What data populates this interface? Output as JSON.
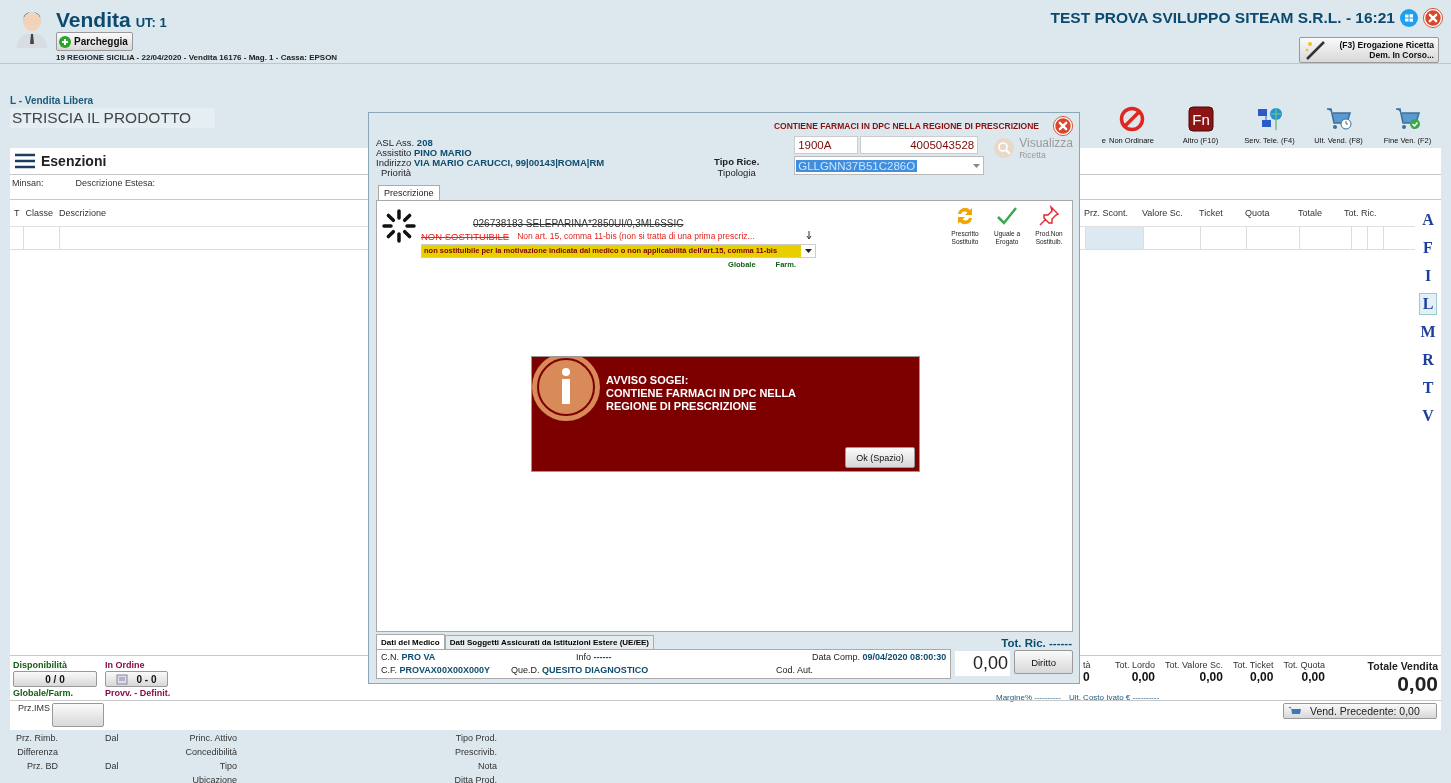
{
  "header": {
    "title": "Vendita",
    "user": "UT: 1",
    "park_button": "Parcheggia",
    "info": "19 REGIONE SICILIA - 22/04/2020 - Vendita 16176 - Mag. 1  - Cassa: EPSON",
    "company": "TEST PROVA SVILUPPO SITEAM S.R.L. - 16:21",
    "recipe_button": [
      "(F3) Erogazione Ricetta",
      "Dem. In Corso..."
    ]
  },
  "sale": {
    "mode": "L - Vendita Libera",
    "scan_prompt": "STRISCIA IL PRODOTTO"
  },
  "toolbar": [
    {
      "label": "e",
      "kind": "hidden"
    },
    {
      "label": "Non Ordinare",
      "kind": "no"
    },
    {
      "label": "Altro (F10)",
      "kind": "fn",
      "glyph": "Fn"
    },
    {
      "label": "Serv. Tele. (F4)",
      "kind": "network"
    },
    {
      "label": "Ult. Vend. (F8)",
      "kind": "recent"
    },
    {
      "label": "Fine Ven. (F2)",
      "kind": "finish"
    }
  ],
  "exemptions": {
    "title": "Esenzioni",
    "fields": [
      "Minsan:",
      "Descrizione Estesa:"
    ]
  },
  "table": {
    "columns_left": [
      "T",
      "Classe",
      "Descrizione"
    ],
    "columns_right": [
      "Prz. Scont.",
      "Valore Sc.",
      "Ticket",
      "Quota",
      "Totale",
      "Tot. Ric."
    ]
  },
  "index_letters": [
    {
      "label": "A",
      "selected": false
    },
    {
      "label": "F",
      "selected": false
    },
    {
      "label": "I",
      "selected": false
    },
    {
      "label": "L",
      "selected": true
    },
    {
      "label": "M",
      "selected": false
    },
    {
      "label": "R",
      "selected": false
    },
    {
      "label": "T",
      "selected": false
    },
    {
      "label": "V",
      "selected": false
    }
  ],
  "availability": {
    "label": "Disponibilità",
    "value": "0 / 0",
    "caption": "Globale/Farm."
  },
  "on_order": {
    "label": "In Ordine",
    "value": "0 - 0",
    "caption": "Provv. - Definit."
  },
  "totals": [
    {
      "label": "tà",
      "value": "0"
    },
    {
      "label": "Tot. Lordo",
      "value": "0,00"
    },
    {
      "label": "Tot. Valore Sc.",
      "value": "0,00"
    },
    {
      "label": "Tot. Ticket",
      "value": "0,00"
    },
    {
      "label": "Tot. Quota",
      "value": "0,00"
    }
  ],
  "grand_total": {
    "label": "Totale Vendita",
    "value": "0,00"
  },
  "margins": [
    "Margine% ----------",
    "Ult. Costo Ivato € ----------"
  ],
  "ims_label": "Prz.IMS",
  "previous_sale_button": "Vend. Precedente: 0,00",
  "details": [
    {
      "price": "Prz. Rimb.",
      "from": "Dal",
      "info": "Princ. Attivo",
      "product": "Tipo Prod."
    },
    {
      "price": "Differenza",
      "info": "Concedibilità",
      "product": "Prescrivib."
    },
    {
      "price": "Prz. BD",
      "from": "Dal",
      "info": "Tipo",
      "product": "Nota"
    },
    {
      "info": "Ubicazione",
      "product": "Ditta Prod."
    }
  ],
  "dialog": {
    "alert": "CONTIENE FARMACI IN DPC NELLA REGIONE DI PRESCRIZIONE",
    "asl": {
      "label": "ASL Ass.",
      "value": "208"
    },
    "patient": {
      "label": "Assistito",
      "value": "PINO MARIO"
    },
    "address": {
      "label": "Indirizzo",
      "value": "VIA MARIO CARUCCI, 99|00143|ROMA|RM"
    },
    "priority_label": "Priorità",
    "type_label": "Tipo Rice.",
    "typology_label": "Tipologia",
    "code": "1900A",
    "number": "4005043528",
    "tax_code": "GLLGNN37B51C286O",
    "view_button": {
      "lines": [
        "Visualizza",
        "Ricetta"
      ],
      "disabled": true
    },
    "tabs": [
      {
        "label": "Prescrizione",
        "selected": true
      }
    ],
    "product": {
      "name": "026738183  SELEPARINA*2850UI/0,3ML6SSIC",
      "status": "NON SOSTITUIBILE",
      "reason": "Non art. 15, comma 11-bis (non si tratta di una prima prescriz...",
      "motivation": "non sostituibile per la motivazione indicata dal medico o non applicabilità dell'art.15, comma 11-bis",
      "scope": [
        "Globale",
        "Farm."
      ]
    },
    "actions": [
      {
        "lines": [
          "Prescritto",
          "Sostituito"
        ],
        "kind": "swap"
      },
      {
        "lines": [
          "Uguale a",
          "Erogato"
        ],
        "kind": "same"
      },
      {
        "lines": [
          "Prod.Non",
          "Sostituib."
        ],
        "kind": "pin"
      }
    ],
    "bottom_tabs": [
      {
        "label": "Dati del Medico",
        "selected": true
      },
      {
        "label": "Dati Soggetti Assicurati da Istituzioni Estere (UE/EE)",
        "selected": false
      }
    ],
    "doctor": {
      "cn": {
        "label": "C.N.",
        "value": "PRO VA"
      },
      "info": {
        "label": "Info",
        "value": "------"
      },
      "date": {
        "label": "Data Comp.",
        "value": "09/04/2020 08:00:30"
      },
      "cf": {
        "label": "C.F.",
        "value": "PROVAX00X00X000Y"
      },
      "qued": {
        "label": "Que.D.",
        "value": "QUESITO DIAGNOSTICO"
      },
      "auth_label": "Cod. Aut."
    },
    "total_label": "Tot. Ric. ------",
    "amount": "0,00",
    "right_button": "Diritto",
    "message": {
      "lines": [
        "AVVISO SOGEI:",
        "CONTIENE FARMACI IN DPC NELLA",
        "REGIONE DI PRESCRIZIONE"
      ],
      "ok_button": "Ok (Spazio)"
    }
  }
}
